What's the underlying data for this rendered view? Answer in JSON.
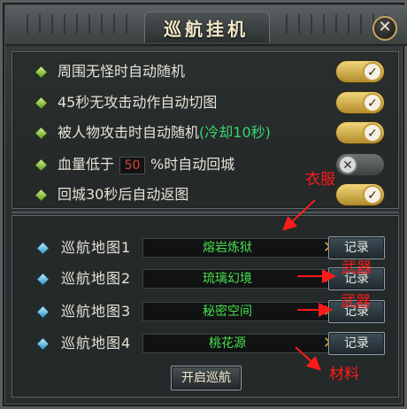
{
  "title": "巡航挂机",
  "close_glyph": "✕",
  "options": [
    {
      "text": "周围无怪时自动随机",
      "on": true
    },
    {
      "text": "45秒无攻击动作自动切图",
      "on": true
    },
    {
      "text": "被人物攻击时自动随机",
      "note": "(冷却10秒)",
      "on": true
    },
    {
      "text_before": "血量低于",
      "value": "50",
      "text_after": "%时自动回城",
      "on": false
    },
    {
      "text": "回城30秒后自动返图",
      "on": true
    }
  ],
  "maps": [
    {
      "label": "巡航地图1",
      "value": "熔岩炼狱"
    },
    {
      "label": "巡航地图2",
      "value": "琉璃幻境"
    },
    {
      "label": "巡航地图3",
      "value": "秘密空间"
    },
    {
      "label": "巡航地图4",
      "value": "桃花源"
    }
  ],
  "record_label": "记录",
  "clear_glyph": "✕",
  "start_button": "开启巡航",
  "annotations": {
    "clothes": "衣服",
    "weapon1": "武器",
    "weapon2": "武器",
    "materials": "材料"
  },
  "colors": {
    "accent_gold": "#e0a52a",
    "map_value_green": "#49e04c",
    "cooldown_green": "#36d66b",
    "annotation_red": "#ff1a1a"
  },
  "icons": {
    "option_bullet": "green-diamond-icon",
    "map_bullet": "blue-diamond-icon",
    "toggle_on": "check-icon",
    "toggle_off": "x-icon"
  }
}
